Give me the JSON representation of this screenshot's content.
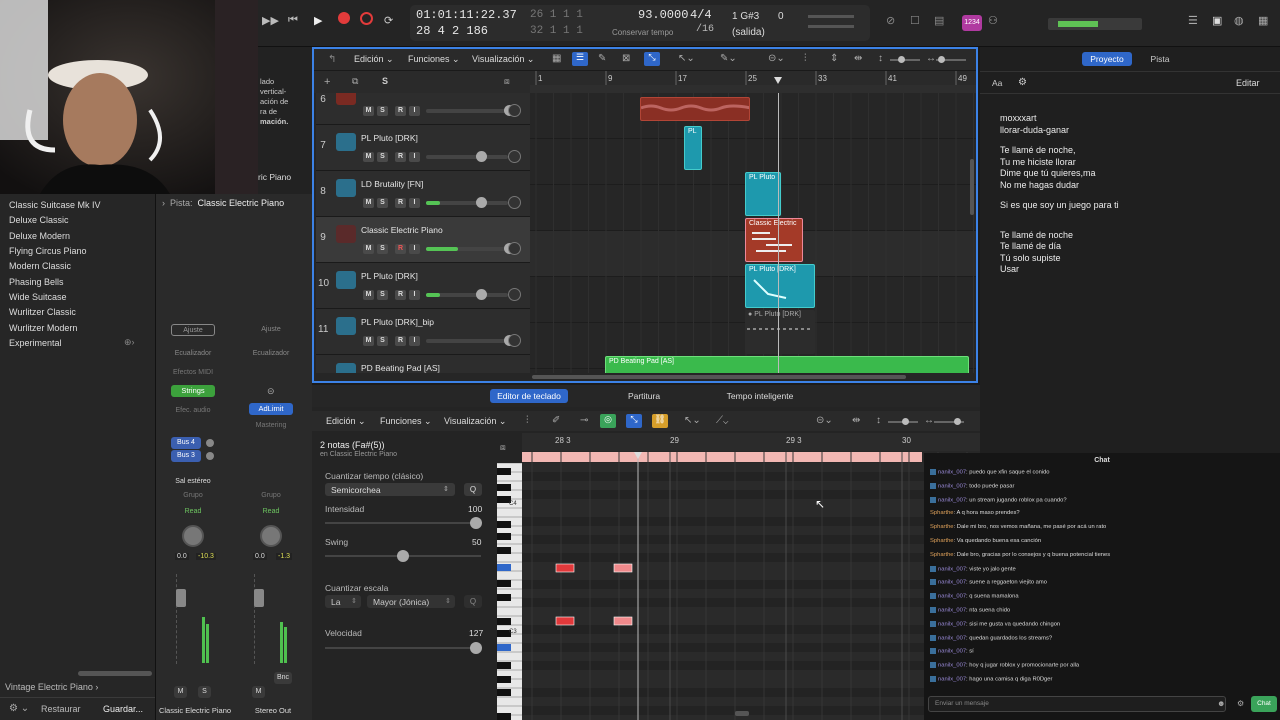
{
  "transport": {
    "position": "01:01:11:22.37",
    "bars_top": "26  1  1    1",
    "bars": "28  4  2  186",
    "bars_bottom": "32  1  1    1",
    "tempo": "93.0000",
    "tempo_label": "Conservar tempo",
    "signature": "4/4",
    "division": "/16",
    "key_info": "1 G#3",
    "key_num": "0",
    "output": "(salida)",
    "badge": "1234"
  },
  "library": {
    "items": [
      "Classic Suitcase Mk IV",
      "Deluxe Classic",
      "Deluxe Modern",
      "Flying Circus Piano",
      "Modern Classic",
      "Phasing Bells",
      "Wide Suitcase",
      "Wurlitzer Classic",
      "Wurlitzer Modern",
      "Experimental"
    ],
    "footer_path": "Vintage Electric Piano",
    "restore": "Restaurar",
    "save": "Guardar..."
  },
  "webcam_overlay": {
    "line1": "lado",
    "line2": "vertical-",
    "line3": "ación de",
    "line4": "ra de",
    "line5": "mación.",
    "line6": "ric Piano"
  },
  "inspector": {
    "track_label": "Pista:",
    "track_name": "Classic Electric Piano",
    "ch1": {
      "ajuste": "Ajuste",
      "eq": "Ecualizador",
      "midi": "Efectos MIDI",
      "plugin": "Strings",
      "audio": "Efec. audio",
      "bus1": "Bus 4",
      "bus2": "Bus 3",
      "out": "Sal estéreo",
      "group": "Grupo",
      "read": "Read",
      "val1": "0.0",
      "val2": "-10.3",
      "m": "M",
      "s": "S",
      "name": "Classic Electric Piano"
    },
    "ch2": {
      "ajuste": "Ajuste",
      "eq": "Ecualizador",
      "plugin": "AdLimit",
      "master": "Mastering",
      "group": "Grupo",
      "read": "Read",
      "val1": "0.0",
      "val2": "-1.3",
      "m": "M",
      "bnc": "Bnc",
      "name": "Stereo Out"
    }
  },
  "tracks_toolbar": {
    "edit": "Edición",
    "functions": "Funciones",
    "view": "Visualización"
  },
  "ruler": [
    "1",
    "9",
    "17",
    "25",
    "33",
    "41",
    "49"
  ],
  "tracks": [
    {
      "num": "6",
      "name": ""
    },
    {
      "num": "7",
      "name": "PL Pluto [DRK]"
    },
    {
      "num": "8",
      "name": "LD Brutality [FN]"
    },
    {
      "num": "9",
      "name": "Classic Electric Piano"
    },
    {
      "num": "10",
      "name": "PL Pluto [DRK]"
    },
    {
      "num": "11",
      "name": "PL Pluto [DRK]_bip"
    },
    {
      "num": "",
      "name": "PD Beating Pad [AS]"
    }
  ],
  "regions": {
    "r7": "PL",
    "r8": "PL Pluto",
    "r9": "Classic Electric",
    "r10": "PL Pluto [DRK]",
    "r11": "PL Pluto [DRK]",
    "r12": "PD Beating Pad [AS]"
  },
  "right_panel": {
    "tab1": "Proyecto",
    "tab2": "Pista",
    "edit": "Editar",
    "aa": "Aa",
    "lyrics": [
      "moxxxart",
      "llorar-duda-ganar",
      "",
      "Te llamé de noche,",
      "Tu me hiciste llorar",
      "Dime que tú quieres,ma",
      "No me hagas dudar",
      "",
      "Si es que soy un juego para ti",
      "",
      "",
      "Te llamé de noche",
      "Te llamé de día",
      "Tú solo supiste",
      "Usar"
    ]
  },
  "editor": {
    "tab1": "Editor de teclado",
    "tab2": "Partitura",
    "tab3": "Tempo inteligente",
    "edit": "Edición",
    "functions": "Funciones",
    "view": "Visualización",
    "notes_title": "2 notas (Fa#(5))",
    "notes_sub": "en Classic Electric Piano",
    "quantize_label": "Cuantizar tiempo (clásico)",
    "quantize_value": "Semicorchea",
    "q": "Q",
    "intensity_label": "Intensidad",
    "intensity_value": "100",
    "swing_label": "Swing",
    "swing_value": "50",
    "scale_label": "Cuantizar escala",
    "scale_root": "La",
    "scale_mode": "Mayor (Jónica)",
    "velocity_label": "Velocidad",
    "velocity_value": "127",
    "ruler": [
      "28 3",
      "29",
      "29 3",
      "30"
    ],
    "c4": "C4",
    "c3": "C3"
  },
  "chat": {
    "title": "Chat",
    "messages": [
      {
        "user": "nanilx_007",
        "text": "puedo que xfin saque el conido"
      },
      {
        "user": "nanilx_007",
        "text": "todo puede pasar"
      },
      {
        "user": "nanilx_007",
        "text": "un stream jugando roblox pa cuando?"
      },
      {
        "user": "Spharthe",
        "text": "A q hora maso prendes?"
      },
      {
        "user": "Spharthe",
        "text": "Dale mi bro, nos vemos mañana, me pasé por acá un rato"
      },
      {
        "user": "Spharthe",
        "text": "Va quedando buena esa canción"
      },
      {
        "user": "Spharthe",
        "text": "Dale bro, gracias por lo consejos y q buena potencial tienes"
      },
      {
        "user": "nanilx_007",
        "text": "viste yo jalo gente"
      },
      {
        "user": "nanilx_007",
        "text": "suene a reggaeton viejito amo"
      },
      {
        "user": "nanilx_007",
        "text": "q suena mamalona"
      },
      {
        "user": "nanilx_007",
        "text": "nta suena chido"
      },
      {
        "user": "nanilx_007",
        "text": "sisi me gusta va quedando chingon"
      },
      {
        "user": "nanilx_007",
        "text": "quedan guardados los streams?"
      },
      {
        "user": "nanilx_007",
        "text": "sí"
      },
      {
        "user": "nanilx_007",
        "text": "hoy q jugar roblox y promocionarte por alla"
      },
      {
        "user": "nanilx_007",
        "text": "hago una camisa q diga R0Dger"
      }
    ],
    "input_placeholder": "Enviar un mensaje",
    "send": "Chat"
  }
}
